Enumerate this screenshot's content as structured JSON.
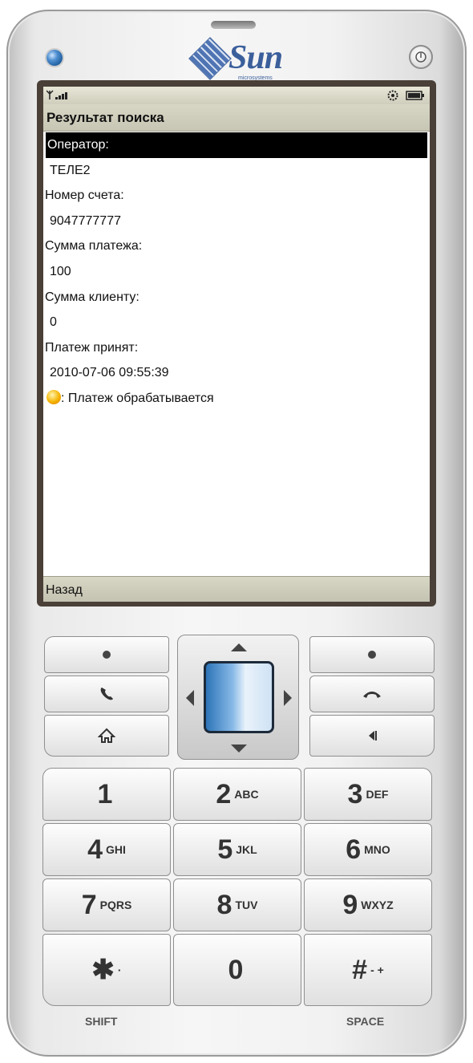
{
  "device": {
    "brand": "Sun",
    "brand_sub": "microsystems"
  },
  "screen": {
    "title": "Результат поиска",
    "rows": [
      {
        "text": "Оператор:",
        "kind": "label",
        "selected": true
      },
      {
        "text": "ТЕЛЕ2",
        "kind": "value"
      },
      {
        "text": "Номер счета:",
        "kind": "label"
      },
      {
        "text": "9047777777",
        "kind": "value"
      },
      {
        "text": "Сумма платежа:",
        "kind": "label"
      },
      {
        "text": "100",
        "kind": "value"
      },
      {
        "text": "Сумма клиенту:",
        "kind": "label"
      },
      {
        "text": "0",
        "kind": "value"
      },
      {
        "text": "Платеж принят:",
        "kind": "label"
      },
      {
        "text": "2010-07-06 09:55:39",
        "kind": "value"
      }
    ],
    "status_message": ": Платеж обрабатывается",
    "status_icon": "warning-icon",
    "softkey_left": "Назад"
  },
  "keypad": {
    "keys": [
      {
        "num": "1",
        "letters": ""
      },
      {
        "num": "2",
        "letters": "ABC"
      },
      {
        "num": "3",
        "letters": "DEF"
      },
      {
        "num": "4",
        "letters": "GHI"
      },
      {
        "num": "5",
        "letters": "JKL"
      },
      {
        "num": "6",
        "letters": "MNO"
      },
      {
        "num": "7",
        "letters": "PQRS"
      },
      {
        "num": "8",
        "letters": "TUV"
      },
      {
        "num": "9",
        "letters": "WXYZ"
      },
      {
        "num": "✱",
        "letters": "·"
      },
      {
        "num": "0",
        "letters": ""
      },
      {
        "num": "#",
        "letters": "- +"
      }
    ],
    "shift_label": "SHIFT",
    "space_label": "SPACE"
  }
}
